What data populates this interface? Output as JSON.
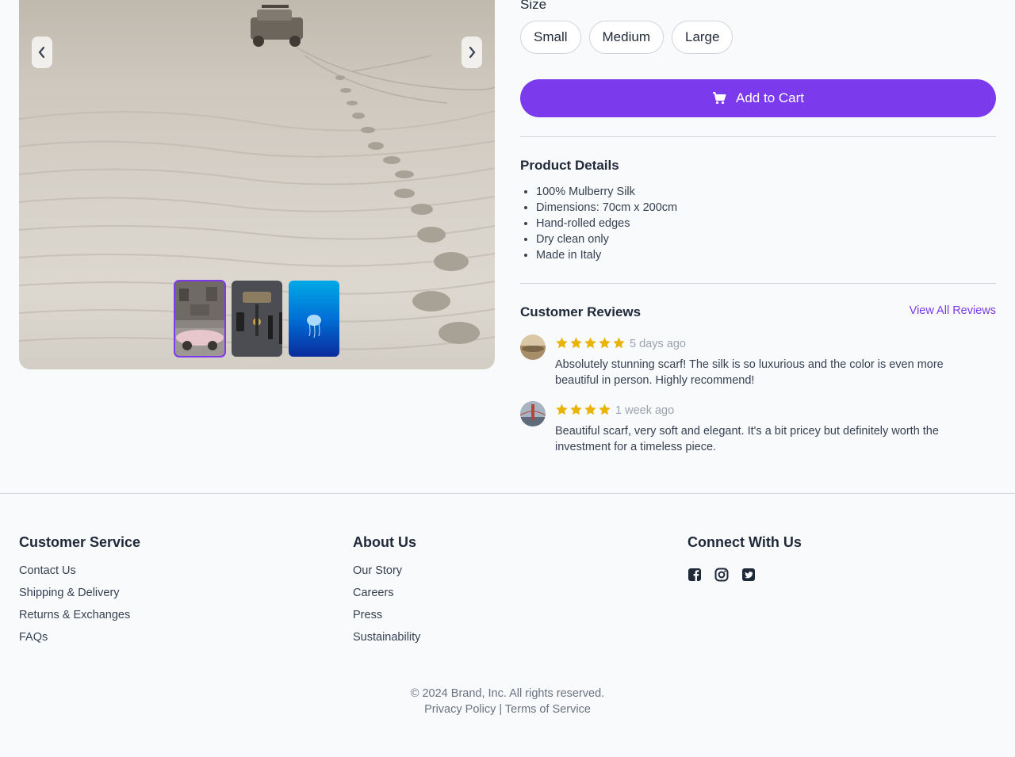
{
  "gallery": {
    "prev_icon": "chevron-left-icon",
    "next_icon": "chevron-right-icon",
    "thumbnails": [
      {
        "name": "old-car-street",
        "active": true
      },
      {
        "name": "accessories-flatlay",
        "active": false
      },
      {
        "name": "jellyfish-underwater",
        "active": false
      }
    ]
  },
  "size": {
    "label": "Size",
    "options": [
      "Small",
      "Medium",
      "Large"
    ]
  },
  "cart": {
    "label": "Add to Cart",
    "icon": "cart-icon"
  },
  "details": {
    "title": "Product Details",
    "items": [
      "100% Mulberry Silk",
      "Dimensions: 70cm x 200cm",
      "Hand-rolled edges",
      "Dry clean only",
      "Made in Italy"
    ]
  },
  "reviews": {
    "title": "Customer Reviews",
    "view_all": "View All Reviews",
    "items": [
      {
        "rating": 5,
        "date": "5 days ago",
        "text": "Absolutely stunning scarf! The silk is so luxurious and the color is even more beautiful in person. Highly recommend!"
      },
      {
        "rating": 4,
        "date": "1 week ago",
        "text": "Beautiful scarf, very soft and elegant. It's a bit pricey but definitely worth the investment for a timeless piece."
      }
    ]
  },
  "footer": {
    "customer_service": {
      "title": "Customer Service",
      "links": [
        "Contact Us",
        "Shipping & Delivery",
        "Returns & Exchanges",
        "FAQs"
      ]
    },
    "about": {
      "title": "About Us",
      "links": [
        "Our Story",
        "Careers",
        "Press",
        "Sustainability"
      ]
    },
    "connect": {
      "title": "Connect With Us",
      "icons": [
        "facebook-icon",
        "instagram-icon",
        "twitter-icon"
      ]
    },
    "copyright": "© 2024 Brand, Inc. All rights reserved.",
    "privacy": "Privacy Policy",
    "separator": "|",
    "terms": "Terms of Service"
  },
  "colors": {
    "accent": "#7c3aed",
    "star": "#eab308"
  }
}
